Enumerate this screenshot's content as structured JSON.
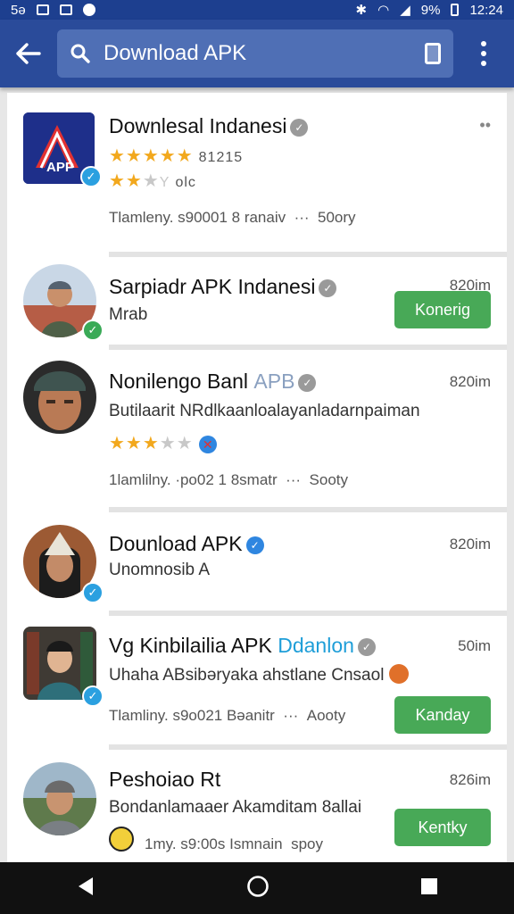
{
  "status_bar": {
    "carrier": "5ə",
    "percent": "9%",
    "clock": "12:24"
  },
  "search": {
    "value": "Download APK",
    "placeholder": "Download APK"
  },
  "items": [
    {
      "title": "Downlesal Indanesi",
      "rating_count": "81215",
      "rating2_label": "olc",
      "meta_text": "Tlamleny. s90001 8 ranaiv",
      "dots": "···",
      "meta_tail": "50ory"
    },
    {
      "title": "Sarpiadr APK Indanesi",
      "subtitle": "Mrab",
      "size": "820im",
      "button": "Konerig"
    },
    {
      "title": "Nonilengo Banl",
      "title_tag": "APB",
      "subtitle": "Butilaarit NRdlkaanloalayanladarnpaiman",
      "size": "820im",
      "meta_text": "1lamlilny. ·po02 1 8smatr",
      "dots": "···",
      "meta_tail": "Sooty"
    },
    {
      "title": "Dounload APK",
      "subtitle": "Unomnosib A",
      "size": "820im"
    },
    {
      "title": "Vg Kinbilailia APK",
      "title_tag": "Ddanlon",
      "subtitle": "Uhaha ABsibəryaka ahstlane Cnsaol",
      "size": "50im",
      "meta_text": "Tlamliny. s9o021 Bəanitr",
      "dots": "···",
      "meta_tail": "Aooty",
      "button": "Kanday"
    },
    {
      "title": "Peshoiao Rt",
      "subtitle": "Bondanlamaaer Akamditam 8allai",
      "size": "826im",
      "meta_text": "1my. s9:00s Ismnain",
      "meta_tail": "spoy",
      "button": "Kentky"
    }
  ],
  "colors": {
    "app_bar": "#2a4b9a",
    "status_bar": "#1d3f8f",
    "search_field": "#4f6fb5",
    "button_green": "#48a957",
    "star": "#f2a81d",
    "nav_bar": "#111111"
  }
}
